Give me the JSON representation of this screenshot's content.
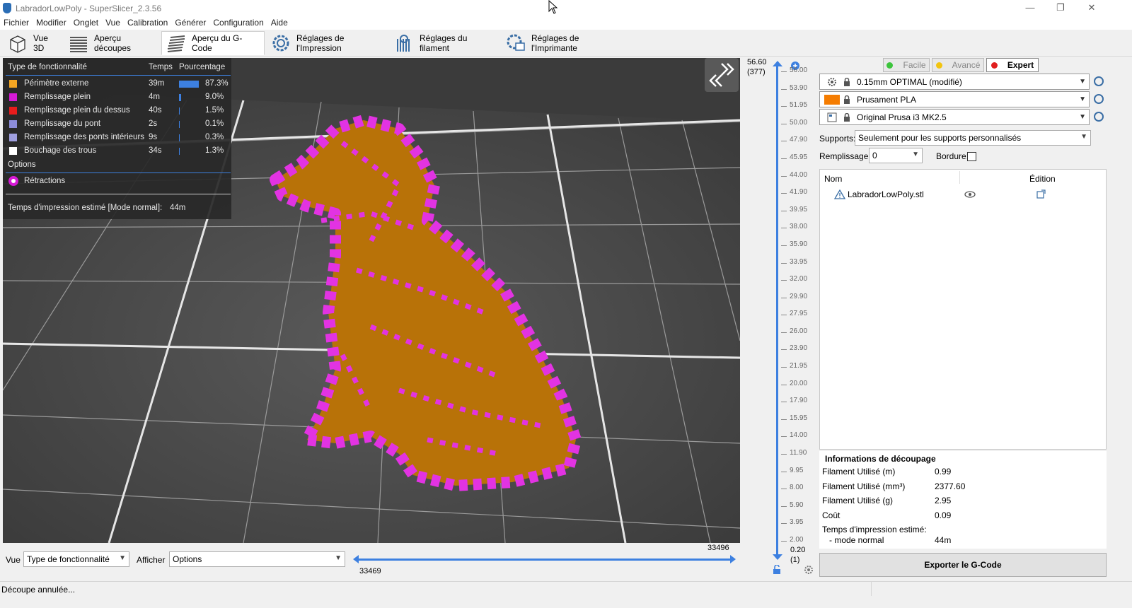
{
  "window": {
    "title": "LabradorLowPoly - SuperSlicer_2.3.56",
    "minimize": "—",
    "restore": "❐",
    "close": "✕"
  },
  "menu": [
    "Fichier",
    "Modifier",
    "Onglet",
    "Vue",
    "Calibration",
    "Générer",
    "Configuration",
    "Aide"
  ],
  "tabs": [
    {
      "label": "Vue 3D",
      "icon": "cube-icon"
    },
    {
      "label": "Aperçu découpes",
      "icon": "layers-icon"
    },
    {
      "label": "Aperçu du G-Code",
      "icon": "gcode-layers-icon",
      "active": true
    },
    {
      "label": "Réglages de l'Impression",
      "icon": "print-settings-gear-icon"
    },
    {
      "label": "Réglages du filament",
      "icon": "filament-spool-icon"
    },
    {
      "label": "Réglages de l'Imprimante",
      "icon": "printer-gear-icon"
    }
  ],
  "legend": {
    "headers": {
      "type": "Type de fonctionnalité",
      "time": "Temps",
      "pct": "Pourcentage"
    },
    "rows": [
      {
        "name": "Périmètre externe",
        "time": "39m",
        "pct": "87.3%",
        "frac": 0.873,
        "color": "#f5a623"
      },
      {
        "name": "Remplissage plein",
        "time": "4m",
        "pct": "9.0%",
        "frac": 0.09,
        "color": "#d61ad6"
      },
      {
        "name": "Remplissage plein du dessus",
        "time": "40s",
        "pct": "1.5%",
        "frac": 0.015,
        "color": "#e81c1c"
      },
      {
        "name": "Remplissage du pont",
        "time": "2s",
        "pct": "0.1%",
        "frac": 0.001,
        "color": "#8c8cd9"
      },
      {
        "name": "Remplissage des ponts intérieurs",
        "time": "9s",
        "pct": "0.3%",
        "frac": 0.003,
        "color": "#a0a0e0"
      },
      {
        "name": "Bouchage des trous",
        "time": "34s",
        "pct": "1.3%",
        "frac": 0.013,
        "color": "#ffffff"
      }
    ],
    "options_label": "Options",
    "retractions": "Rétractions",
    "estimated": "Temps d'impression estimé [Mode normal]:",
    "estimated_value": "44m"
  },
  "bottom": {
    "vue_label": "Vue",
    "vue_value": "Type de fonctionnalité",
    "afficher_label": "Afficher",
    "afficher_value": "Options",
    "h_min": "33469",
    "h_max": "33496"
  },
  "vslider": {
    "top_value": "56.60",
    "top_layer": "(377)",
    "bottom_value": "0.20",
    "bottom_layer": "(1)",
    "ticks": [
      "56.00",
      "53.90",
      "51.95",
      "50.00",
      "47.90",
      "45.95",
      "44.00",
      "41.90",
      "39.95",
      "38.00",
      "35.90",
      "33.95",
      "32.00",
      "29.90",
      "27.95",
      "26.00",
      "23.90",
      "21.95",
      "20.00",
      "17.90",
      "15.95",
      "14.00",
      "11.90",
      "9.95",
      "8.00",
      "5.90",
      "3.95",
      "2.00"
    ]
  },
  "modes": [
    {
      "label": "Facile",
      "color": "#3cc43c",
      "active": false
    },
    {
      "label": "Avancé",
      "color": "#f2c40f",
      "active": false
    },
    {
      "label": "Expert",
      "color": "#e01f1f",
      "active": true
    }
  ],
  "presets": {
    "print": "0.15mm OPTIMAL (modifié)",
    "filament": "Prusament PLA",
    "filament_color": "#f57c00",
    "printer": "Original Prusa i3 MK2.5"
  },
  "supports": {
    "label": "Supports:",
    "value": "Seulement pour les supports personnalisés"
  },
  "infill": {
    "label": "Remplissage:",
    "value": "0"
  },
  "brim": {
    "label": "Bordure:"
  },
  "objects": {
    "col_name": "Nom",
    "col_edit": "Édition",
    "items": [
      {
        "name": "LabradorLowPoly.stl"
      }
    ]
  },
  "slice_info": {
    "title": "Informations de découpage",
    "rows": [
      {
        "label": "Filament Utilisé (m)",
        "value": "0.99"
      },
      {
        "label": "Filament Utilisé (mm³)",
        "value": "2377.60"
      },
      {
        "label": "Filament Utilisé (g)",
        "value": "2.95"
      },
      {
        "label": "Coût",
        "value": "0.09"
      }
    ],
    "time_label": "Temps d'impression estimé:",
    "mode_label": "- mode normal",
    "time_value": "44m"
  },
  "export_label": "Exporter le G-Code",
  "status": "Découpe annulée..."
}
